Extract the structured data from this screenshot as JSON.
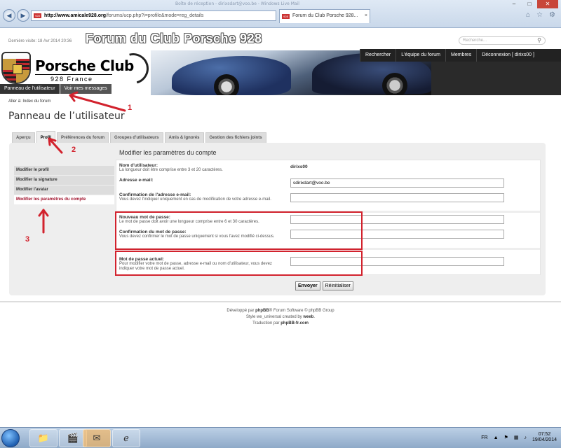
{
  "browser": {
    "window_title": "Boîte de réception - dirixsdart@voo.be - Windows Live Mail",
    "url_host": "http://www.amicale928.org",
    "url_rest": "/forums/ucp.php?i=profile&mode=reg_details",
    "tab_title": "Forum du Club Porsche 928...",
    "favicon_text": "928"
  },
  "header": {
    "last_visit": "Dernière visite: 18 Avr 2014 20:36",
    "forum_title": "Forum du Club Porsche 928",
    "search_placeholder": "Recherche...",
    "brand": "Porsche Club",
    "brand_sub": "928 France"
  },
  "topnav": [
    "Rechercher",
    "L'équipe du forum",
    "Membres",
    "Déconnexion [ dirixs00 ]"
  ],
  "subnav": [
    "Panneau de l'utilisateur",
    "Voir mes messages"
  ],
  "breadcrumb": "Aller à: Index du forum",
  "page_title": "Panneau de l’utilisateur",
  "tabs": [
    "Aperçu",
    "Profil",
    "Préférences du forum",
    "Groupes d'utilisateurs",
    "Amis & Ignorés",
    "Gestion des fichiers joints"
  ],
  "section_title": "Modifier les paramètres du compte",
  "sidemenu": [
    "Modifier le profil",
    "Modifier la signature",
    "Modifier l'avatar",
    "Modifier les paramètres du compte"
  ],
  "form": {
    "username_label": "Nom d'utilisateur:",
    "username_hint": "La longueur doit être comprise entre 3 et 20 caractères.",
    "username_value": "dirixs00",
    "email_label": "Adresse e-mail:",
    "email_value": "sdirixdart@voo.be",
    "email_confirm_label": "Confirmation de l'adresse e-mail:",
    "email_confirm_hint": "Vous devez l'indiquer uniquement en cas de modification de votre adresse e-mail.",
    "new_pw_label": "Nouveau mot de passe:",
    "new_pw_hint": "Le mot de passe doit avoir une longueur comprise entre 6 et 30 caractères.",
    "confirm_pw_label": "Confirmation du mot de passe:",
    "confirm_pw_hint": "Vous devez confirmer le mot de passe uniquement si vous l'avez modifié ci-dessus.",
    "current_pw_label": "Mot de passe actuel:",
    "current_pw_hint": "Pour modifier votre mot de passe, adresse e-mail ou nom d'utilisateur, vous devez indiquer votre mot de passe actuel.",
    "submit": "Envoyer",
    "reset": "Réinitialiser"
  },
  "footer": {
    "line1_pre": "Développé par ",
    "line1_phpbb": "phpBB",
    "line1_post": "® Forum Software © phpBB Group",
    "line2_pre": "Style we_universal created by ",
    "line2_name": "weeb",
    "line3_pre": "Traduction par ",
    "line3_name": "phpBB-fr.com"
  },
  "annotations": [
    "1",
    "2",
    "3"
  ],
  "taskbar": {
    "lang": "FR",
    "time": "07:52",
    "date": "19/04/2014"
  },
  "colors": {
    "accent_red": "#d2222d",
    "active_menu": "#a0102b"
  }
}
